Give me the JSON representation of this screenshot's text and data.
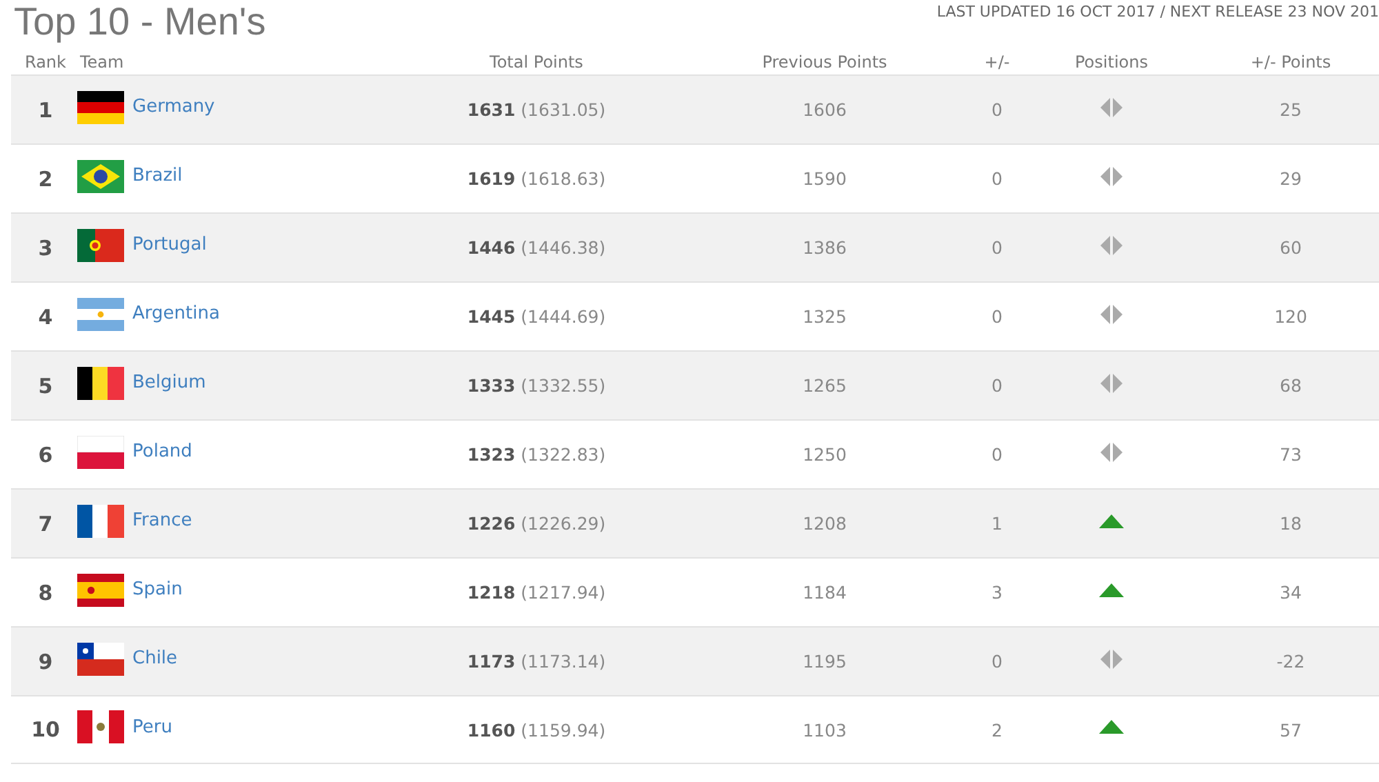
{
  "page": {
    "title": "Top 10 - Men's",
    "update_note": "LAST UPDATED 16 OCT 2017 / NEXT RELEASE 23 NOV 201"
  },
  "table": {
    "columns": [
      "Rank",
      "Team",
      "Total Points",
      "Previous Points",
      "+/-",
      "Positions",
      "+/- Points"
    ],
    "rows": [
      {
        "rank": "1",
        "team": "Germany",
        "total": "1631",
        "total_exact": "(1631.05)",
        "previous": "1606",
        "change": "0",
        "moved_up": false,
        "points_change": "25"
      },
      {
        "rank": "2",
        "team": "Brazil",
        "total": "1619",
        "total_exact": "(1618.63)",
        "previous": "1590",
        "change": "0",
        "moved_up": false,
        "points_change": "29"
      },
      {
        "rank": "3",
        "team": "Portugal",
        "total": "1446",
        "total_exact": "(1446.38)",
        "previous": "1386",
        "change": "0",
        "moved_up": false,
        "points_change": "60"
      },
      {
        "rank": "4",
        "team": "Argentina",
        "total": "1445",
        "total_exact": "(1444.69)",
        "previous": "1325",
        "change": "0",
        "moved_up": false,
        "points_change": "120"
      },
      {
        "rank": "5",
        "team": "Belgium",
        "total": "1333",
        "total_exact": "(1332.55)",
        "previous": "1265",
        "change": "0",
        "moved_up": false,
        "points_change": "68"
      },
      {
        "rank": "6",
        "team": "Poland",
        "total": "1323",
        "total_exact": "(1322.83)",
        "previous": "1250",
        "change": "0",
        "moved_up": false,
        "points_change": "73"
      },
      {
        "rank": "7",
        "team": "France",
        "total": "1226",
        "total_exact": "(1226.29)",
        "previous": "1208",
        "change": "1",
        "moved_up": true,
        "points_change": "18"
      },
      {
        "rank": "8",
        "team": "Spain",
        "total": "1218",
        "total_exact": "(1217.94)",
        "previous": "1184",
        "change": "3",
        "moved_up": true,
        "points_change": "34"
      },
      {
        "rank": "9",
        "team": "Chile",
        "total": "1173",
        "total_exact": "(1173.14)",
        "previous": "1195",
        "change": "0",
        "moved_up": false,
        "points_change": "-22"
      },
      {
        "rank": "10",
        "team": "Peru",
        "total": "1160",
        "total_exact": "(1159.94)",
        "previous": "1103",
        "change": "2",
        "moved_up": true,
        "points_change": "57"
      }
    ]
  }
}
